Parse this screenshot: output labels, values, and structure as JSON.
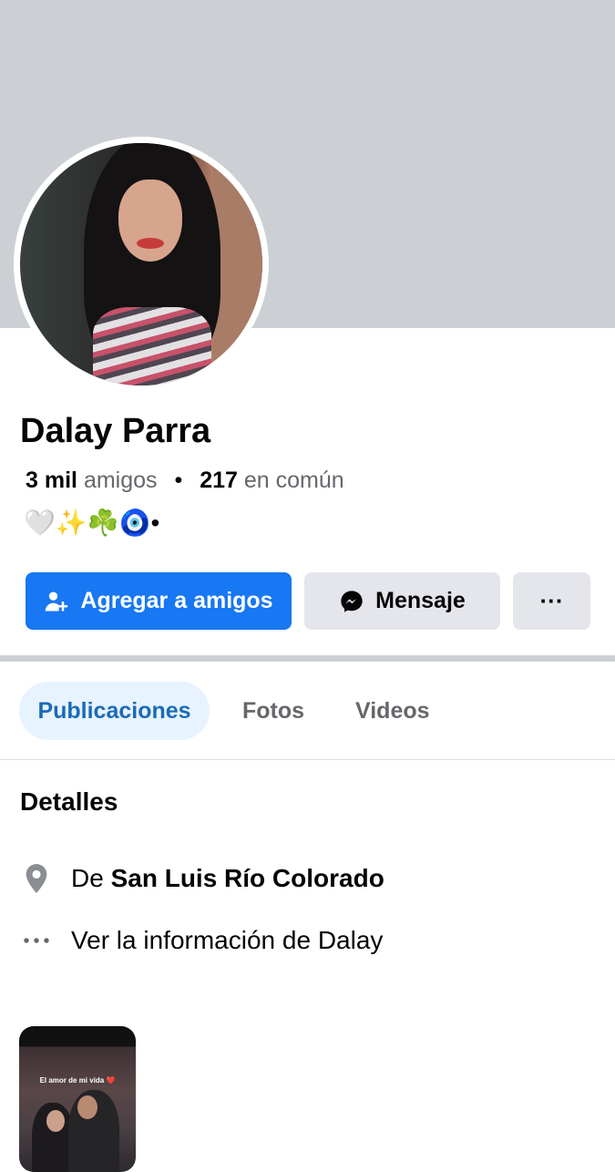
{
  "profile": {
    "name": "Dalay Parra",
    "friends_count": "3 mil",
    "friends_label": "amigos",
    "mutual_count": "217",
    "mutual_label": "en común",
    "separator": "•",
    "bio": "🤍✨☘️🧿•"
  },
  "actions": {
    "add_friend": "Agregar a amigos",
    "message": "Mensaje",
    "more": "···"
  },
  "tabs": [
    {
      "label": "Publicaciones",
      "active": true
    },
    {
      "label": "Fotos",
      "active": false
    },
    {
      "label": "Videos",
      "active": false
    }
  ],
  "details": {
    "title": "Detalles",
    "location_prefix": "De",
    "location": "San Luis Río Colorado",
    "more_info": "Ver la información de Dalay"
  },
  "featured": {
    "caption": "El amor de mi vida ❤️"
  },
  "colors": {
    "primary": "#1877f2",
    "secondary_button": "#e4e6eb",
    "cover": "#ccd0d5",
    "active_tab_bg": "#e7f3ff",
    "active_tab_text": "#1b6bb8",
    "muted_text": "#65676b"
  },
  "icons": {
    "add_friend": "person-plus-icon",
    "message": "messenger-icon",
    "location": "map-pin-icon",
    "more_info": "ellipsis-icon"
  }
}
